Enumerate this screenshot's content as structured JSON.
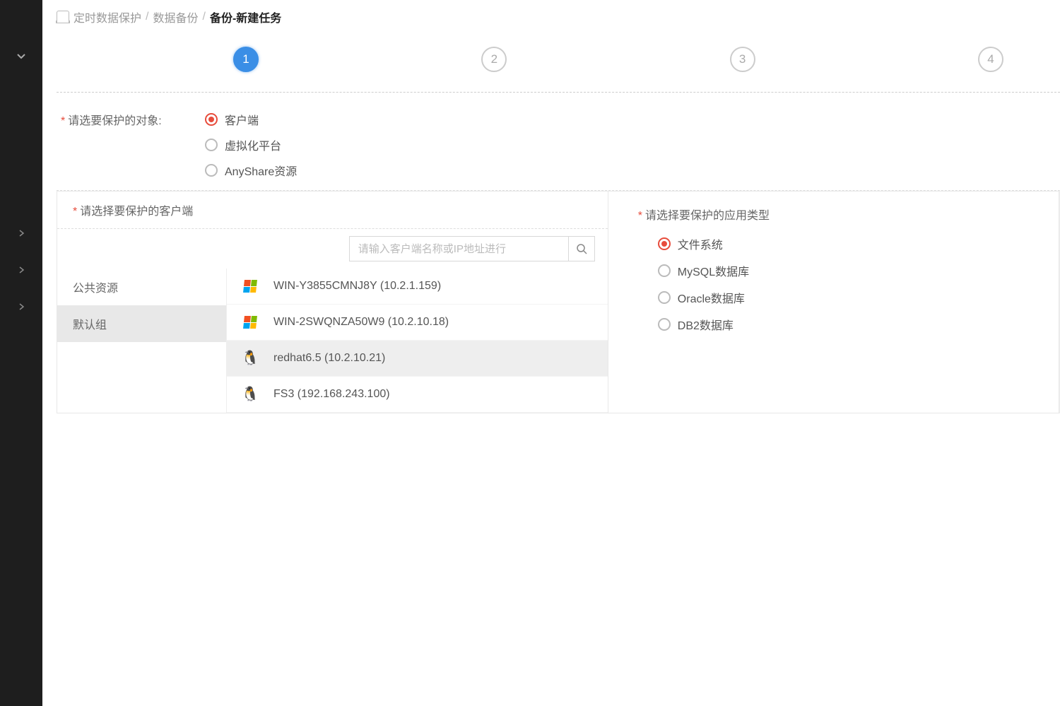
{
  "breadcrumb": {
    "path1": "定时数据保护",
    "path2": "数据备份",
    "current": "备份-新建任务"
  },
  "steps": [
    "1",
    "2",
    "3",
    "4"
  ],
  "object_section": {
    "label": "请选要保护的对象:",
    "options": {
      "client": "客户端",
      "virtual": "虚拟化平台",
      "anyshare": "AnyShare资源"
    }
  },
  "client_panel": {
    "title": "请选择要保护的客户端",
    "search_placeholder": "请输入客户端名称或IP地址进行",
    "groups": {
      "public": "公共资源",
      "default": "默认组"
    },
    "clients": [
      {
        "os": "windows",
        "label": "WIN-Y3855CMNJ8Y (10.2.1.159)"
      },
      {
        "os": "windows",
        "label": "WIN-2SWQNZA50W9 (10.2.10.18)"
      },
      {
        "os": "linux",
        "label": "redhat6.5 (10.2.10.21)"
      },
      {
        "os": "linux",
        "label": "FS3 (192.168.243.100)"
      }
    ]
  },
  "apptype_panel": {
    "label": "请选择要保护的应用类型",
    "options": {
      "fs": "文件系统",
      "mysql": "MySQL数据库",
      "oracle": "Oracle数据库",
      "db2": "DB2数据库"
    }
  }
}
